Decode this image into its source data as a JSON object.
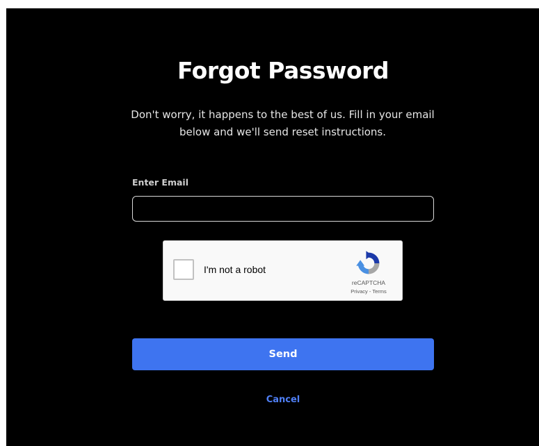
{
  "form": {
    "title": "Forgot Password",
    "subtitle": "Don't worry, it happens to the best of us. Fill in your email below and we'll send reset instructions.",
    "email_label": "Enter Email",
    "email_value": "",
    "send_label": "Send",
    "cancel_label": "Cancel"
  },
  "recaptcha": {
    "checkbox_label": "I'm not a robot",
    "brand": "reCAPTCHA",
    "links": "Privacy - Terms",
    "icon": "recaptcha-logo-icon"
  },
  "colors": {
    "background": "#000000",
    "accent": "#3e74f0",
    "link": "#4f7ff5"
  }
}
